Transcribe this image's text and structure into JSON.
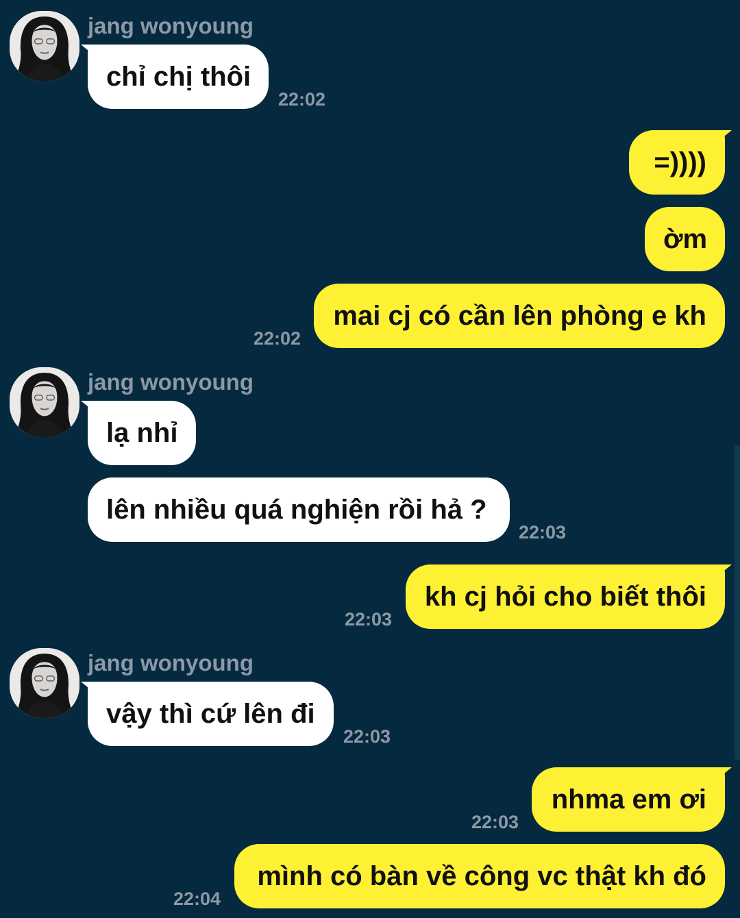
{
  "contact": {
    "name": "jang wonyoung",
    "avatar_icon": "avatar-photo-icon"
  },
  "colors": {
    "background": "#052a3f",
    "incoming_bubble": "#ffffff",
    "outgoing_bubble": "#fef033",
    "meta_text": "#8d98a6"
  },
  "messages": [
    {
      "direction": "in",
      "text": "chỉ chị thôi",
      "time": "22:02"
    },
    {
      "direction": "out",
      "text": "=))))",
      "time": ""
    },
    {
      "direction": "out",
      "text": "ờm",
      "time": ""
    },
    {
      "direction": "out",
      "text": "mai cj có cần lên phòng e kh",
      "time": "22:02"
    },
    {
      "direction": "in",
      "text": "lạ nhỉ",
      "time": ""
    },
    {
      "direction": "in",
      "text": "lên nhiều quá nghiện rồi hả ?",
      "time": "22:03"
    },
    {
      "direction": "out",
      "text": "kh cj hỏi cho biết thôi",
      "time": "22:03"
    },
    {
      "direction": "in",
      "text": "vậy thì cứ lên đi",
      "time": "22:03"
    },
    {
      "direction": "out",
      "text": "nhma em ơi",
      "time": "22:03"
    },
    {
      "direction": "out",
      "text": "mình có bàn về công vc thật kh đó",
      "time": "22:04"
    }
  ]
}
